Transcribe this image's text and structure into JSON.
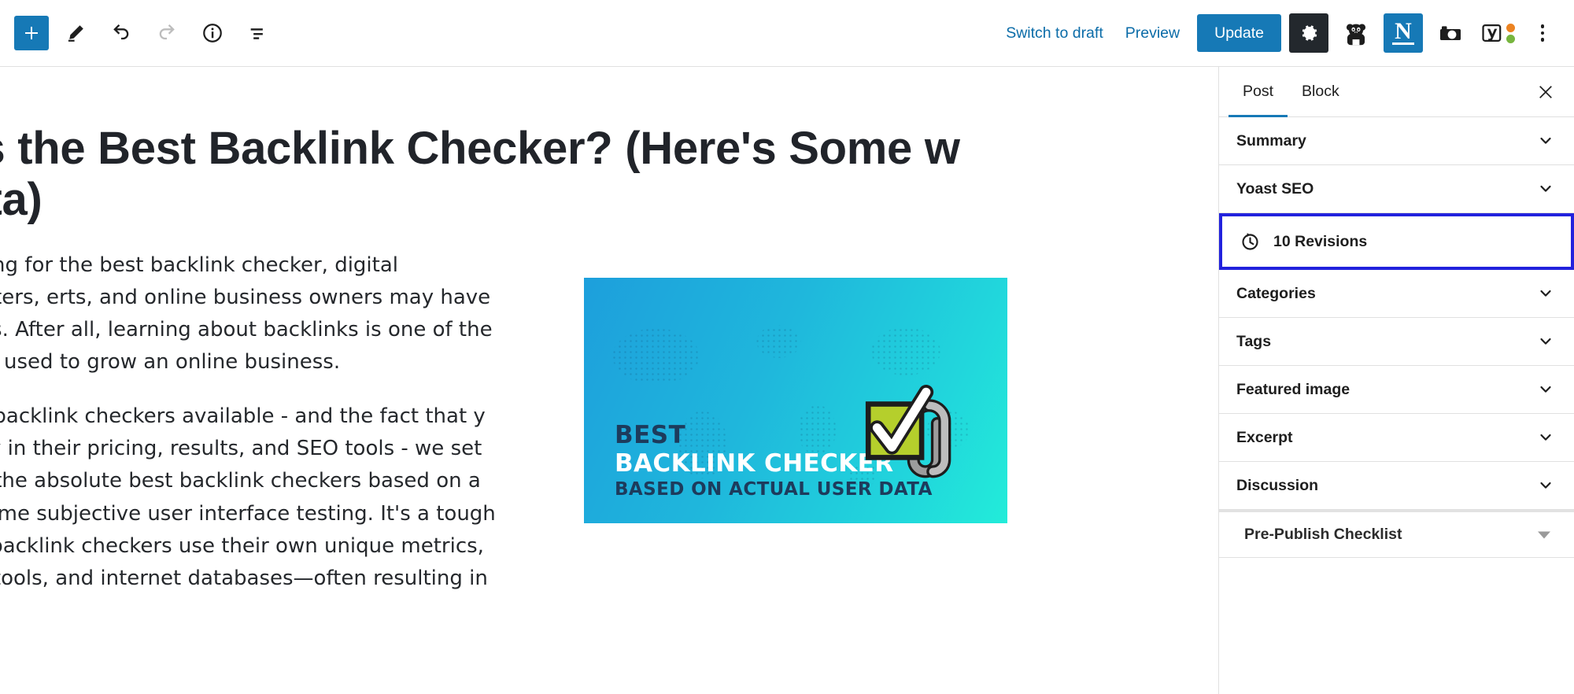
{
  "toolbar": {
    "left_tools": [
      {
        "name": "add-block-button",
        "label": "Add block",
        "icon": "plus-icon"
      },
      {
        "name": "edit-tool-button",
        "label": "Tools",
        "icon": "pencil-icon"
      },
      {
        "name": "undo-button",
        "label": "Undo",
        "icon": "undo-arrow-icon"
      },
      {
        "name": "redo-button",
        "label": "Redo",
        "icon": "redo-arrow-icon"
      },
      {
        "name": "details-button",
        "label": "Details",
        "icon": "info-circle-icon"
      },
      {
        "name": "list-view-button",
        "label": "List View",
        "icon": "list-view-icon"
      }
    ],
    "switch_to_draft": "Switch to draft",
    "preview": "Preview",
    "update": "Update",
    "plugins": [
      {
        "name": "settings-button",
        "icon": "gear-icon",
        "title": "Settings"
      },
      {
        "name": "panda-plugin-button",
        "icon": "panda-icon",
        "title": "Panda"
      },
      {
        "name": "nitropack-plugin-button",
        "icon": "letter-n-icon",
        "title": "N"
      },
      {
        "name": "screenshot-plugin-button",
        "icon": "camera-icon",
        "title": "Camera"
      },
      {
        "name": "yoast-seo-button",
        "icon": "yoast-y-icon",
        "title": "Yoast SEO"
      },
      {
        "name": "options-menu-button",
        "icon": "kebab-menu-icon",
        "title": "Options"
      }
    ],
    "colors": {
      "accent_blue": "#1679B6",
      "link_blue": "#0b6ca8",
      "dark": "#23282d",
      "yoast_orange": "#ec8321",
      "yoast_green": "#77b53e"
    }
  },
  "editor": {
    "title": "at's the Best Backlink Checker? (Here's Some w Data)",
    "paragraphs": [
      "earching for the best backlink checker, digital marketers, erts, and online business owners may have some s. After all, learning about backlinks is one of the main s used to grow an online business.",
      "many backlink checkers available - and the fact that y greatly in their pricing, results, and SEO tools - we set entify the absolute best backlink checkers based on a and some subjective user interface testing. It's a tough ce all backlink checkers use their own unique metrics, aping tools, and internet databases—often resulting in"
    ]
  },
  "featured_image": {
    "line1": "BEST",
    "line2": "BACKLINK CHECKER",
    "line3": "BASED ON ACTUAL USER DATA",
    "icon": "checkbox-paperclip-icon",
    "colors": {
      "gradient_start": "#1d9fdc",
      "gradient_end": "#22ecd9",
      "navy_text": "#1d3b5c",
      "white_text": "#ffffff",
      "check_box_green": "#b5cf2c",
      "paperclip_grey": "#9c9c9c"
    }
  },
  "sidebar": {
    "tabs": [
      {
        "label": "Post",
        "active": true
      },
      {
        "label": "Block",
        "active": false
      }
    ],
    "close_label": "Close settings",
    "panels": [
      {
        "label": "Summary",
        "toggle": "chevron-down-icon",
        "highlight": false,
        "icon": null
      },
      {
        "label": "Yoast SEO",
        "toggle": "chevron-down-icon",
        "highlight": false,
        "icon": null
      },
      {
        "label": "10 Revisions",
        "toggle": null,
        "highlight": true,
        "icon": "revision-history-icon"
      },
      {
        "label": "Categories",
        "toggle": "chevron-down-icon",
        "highlight": false,
        "icon": null
      },
      {
        "label": "Tags",
        "toggle": "chevron-down-icon",
        "highlight": false,
        "icon": null
      },
      {
        "label": "Featured image",
        "toggle": "chevron-down-icon",
        "highlight": false,
        "icon": null
      },
      {
        "label": "Excerpt",
        "toggle": "chevron-down-icon",
        "highlight": false,
        "icon": null
      },
      {
        "label": "Discussion",
        "toggle": "chevron-down-icon",
        "highlight": false,
        "icon": null
      },
      {
        "label": "Pre-Publish Checklist",
        "toggle": "triangle-down-icon",
        "highlight": false,
        "icon": null
      }
    ],
    "highlight_color": "#2222dd"
  }
}
